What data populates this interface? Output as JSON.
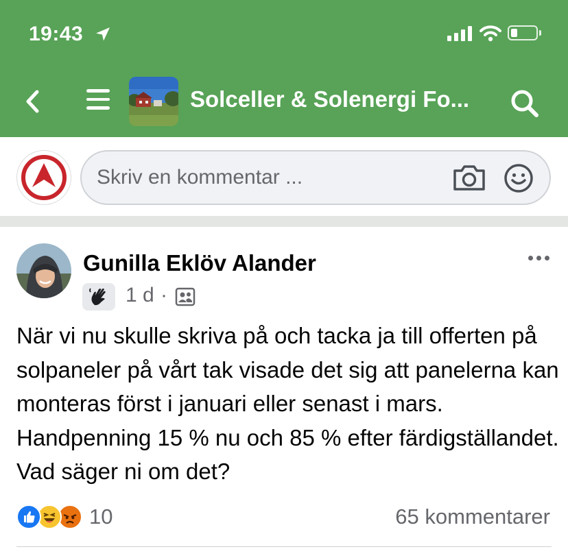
{
  "status_bar": {
    "time": "19:43",
    "icons": [
      "location-arrow-icon",
      "cellular-signal-icon",
      "wifi-icon",
      "battery-icon"
    ]
  },
  "header": {
    "group_title": "Solceller & Solenergi Fo...",
    "icons": [
      "back-chevron-icon",
      "hamburger-menu-icon",
      "search-icon"
    ]
  },
  "composer": {
    "placeholder": "Skriv en kommentar ...",
    "icons": [
      "camera-icon",
      "smiley-icon"
    ]
  },
  "post": {
    "author": "Gunilla Eklöv Alander",
    "time": "1 d",
    "separator": "·",
    "badge_icon": "waving-hand-icon",
    "audience_icon": "group-members-icon",
    "text": "När vi nu skulle skriva på och tacka ja till offerten på solpaneler på vårt tak visade det sig att panelerna kan monteras först i januari eller senast i mars. Handpenning 15 % nu och 85 % efter färdigställandet. Vad säger ni om det?",
    "reactions": {
      "types": [
        "like",
        "haha",
        "angry"
      ],
      "count": "10"
    },
    "comments_label": "65 kommentarer"
  },
  "colors": {
    "header_green": "#58a357",
    "text_secondary": "#65676b",
    "like_blue": "#1877f2",
    "emoji_yellow": "#f7c42f",
    "angry_orange": "#e9710f"
  }
}
